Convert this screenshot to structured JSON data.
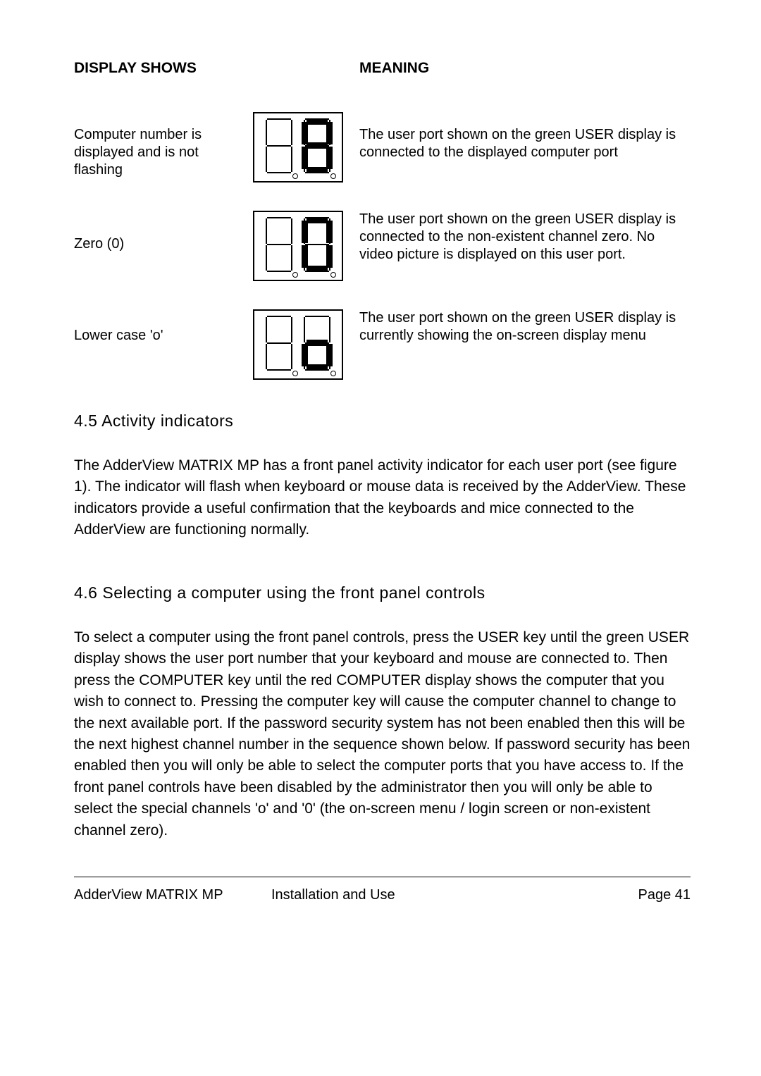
{
  "headers": {
    "display_shows": "DISPLAY SHOWS",
    "meaning": "MEANING"
  },
  "rows": [
    {
      "display": "Computer number is displayed and is not flashing",
      "meaning": "The user port shown on the green USER display is connected to the displayed computer port"
    },
    {
      "display": "Zero (0)",
      "meaning": "The user port shown on the green USER display is connected to the non-existent channel zero. No video picture is displayed on this user port."
    },
    {
      "display": "Lower case 'o'",
      "meaning": "The user port shown on the green USER display is currently showing the on-screen display menu"
    }
  ],
  "sections": {
    "s45_title": "4.5 Activity indicators",
    "s45_body": "The AdderView MATRIX MP has a front panel activity indicator for each user port (see figure 1). The indicator will flash when keyboard or mouse data is received by the AdderView. These indicators provide a useful confirmation that the keyboards and mice connected to the AdderView are functioning normally.",
    "s46_title": "4.6 Selecting a computer using the front panel controls",
    "s46_body": "To select a computer using the front panel controls, press the USER key until the green USER display shows the user port number that your keyboard and mouse are connected to. Then press the COMPUTER key until the red COMPUTER display shows the computer that you wish to connect to. Pressing the computer key will cause the computer channel to change to the next available port. If the password security system has not been enabled then this will be the next highest channel number in the sequence shown below. If password security has been enabled then you will only be able to select the computer ports that you have access to. If the front panel controls have been disabled by the administrator then you will only be able to select the special channels 'o' and '0' (the on-screen menu / login screen or non-existent channel zero)."
  },
  "footer": {
    "left": "AdderView MATRIX MP",
    "center": "Installation and Use",
    "right": "Page 41"
  }
}
